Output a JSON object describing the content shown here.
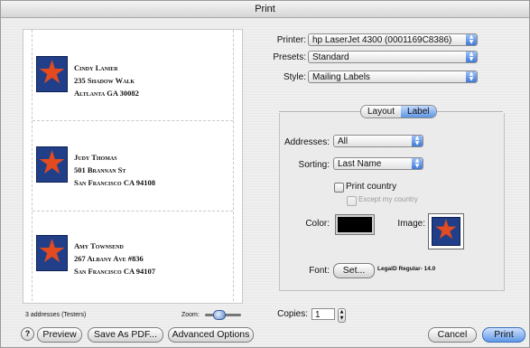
{
  "window": {
    "title": "Print"
  },
  "preview": {
    "labels": [
      {
        "lines": [
          "Cindy Lanier",
          "235 Shadow Walk",
          "Altlanta GA 30082"
        ]
      },
      {
        "lines": [
          "Judy Thomas",
          "501 Brannan St",
          "San Francisco CA 94108"
        ]
      },
      {
        "lines": [
          "Amy Townsend",
          "267 Albany Ave #836",
          "San Francisco CA 94107"
        ]
      }
    ],
    "status": "3 addresses (Testers)",
    "zoom_label": "Zoom:"
  },
  "printer": {
    "label": "Printer:",
    "value": "hp LaserJet 4300 (0001169C8386)"
  },
  "presets": {
    "label": "Presets:",
    "value": "Standard"
  },
  "style": {
    "label": "Style:",
    "value": "Mailing Labels"
  },
  "tabs": [
    {
      "label": "Layout",
      "selected": false
    },
    {
      "label": "Label",
      "selected": true
    }
  ],
  "addresses": {
    "label": "Addresses:",
    "value": "All"
  },
  "sorting": {
    "label": "Sorting:",
    "value": "Last Name"
  },
  "print_country": {
    "label": "Print country",
    "checked": false
  },
  "exclude_country": {
    "label": "Except my country",
    "checked": false
  },
  "color": {
    "label": "Color:",
    "value": "#000000"
  },
  "image": {
    "label": "Image:"
  },
  "font": {
    "label": "Font:",
    "button": "Set...",
    "value": "LegalD Regular- 14.0"
  },
  "copies": {
    "label": "Copies:",
    "value": "1"
  },
  "buttons": {
    "help": "?",
    "preview": "Preview",
    "save_pdf": "Save As PDF...",
    "advanced": "Advanced Options",
    "cancel": "Cancel",
    "print": "Print"
  },
  "colors": {
    "accent": "#5f98e6",
    "stamp_bg": "#213f89",
    "stamp_star": "#e24a20"
  }
}
